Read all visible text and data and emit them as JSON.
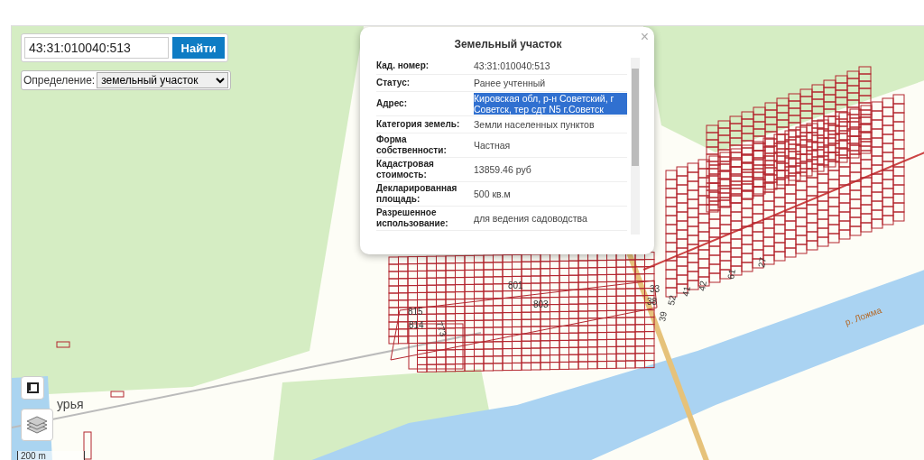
{
  "search": {
    "value": "43:31:010040:513",
    "button": "Найти"
  },
  "definition": {
    "label": "Определение:",
    "value": "земельный участок"
  },
  "popup": {
    "title": "Земельный участок",
    "close": "×",
    "rows": [
      {
        "label": "Кад. номер:",
        "value": "43:31:010040:513",
        "selected": false
      },
      {
        "label": "Статус:",
        "value": "Ранее учтенный",
        "selected": false
      },
      {
        "label": "Адрес:",
        "value": "Кировская обл, р-н Советский, г Советск, тер сдт N5 г.Советск",
        "selected": true
      },
      {
        "label": "Категория земель:",
        "value": "Земли населенных пунктов",
        "selected": false
      },
      {
        "label": "Форма собственности:",
        "value": "Частная",
        "selected": false
      },
      {
        "label": "Кадастровая стоимость:",
        "value": "13859.46 руб",
        "selected": false
      },
      {
        "label": "Декларированная площадь:",
        "value": "500 кв.м",
        "selected": false
      },
      {
        "label": "Разрешенное использование:",
        "value": "для ведения садоводства",
        "selected": false
      }
    ]
  },
  "map_labels": [
    {
      "text": "801",
      "kind": "plot"
    },
    {
      "text": "803",
      "kind": "plot"
    },
    {
      "text": "815",
      "kind": "plot"
    },
    {
      "text": "814",
      "kind": "plot"
    },
    {
      "text": "773",
      "kind": "plot"
    },
    {
      "text": "33",
      "kind": "plot"
    },
    {
      "text": "38",
      "kind": "plot"
    },
    {
      "text": "39",
      "kind": "plot"
    },
    {
      "text": "52",
      "kind": "plot"
    },
    {
      "text": "41",
      "kind": "plot"
    },
    {
      "text": "42",
      "kind": "plot"
    },
    {
      "text": "61",
      "kind": "plot"
    },
    {
      "text": "27",
      "kind": "plot"
    },
    {
      "text": "р. Ложма",
      "kind": "river"
    },
    {
      "text": "урья",
      "kind": "place"
    }
  ],
  "scale": "200 m"
}
